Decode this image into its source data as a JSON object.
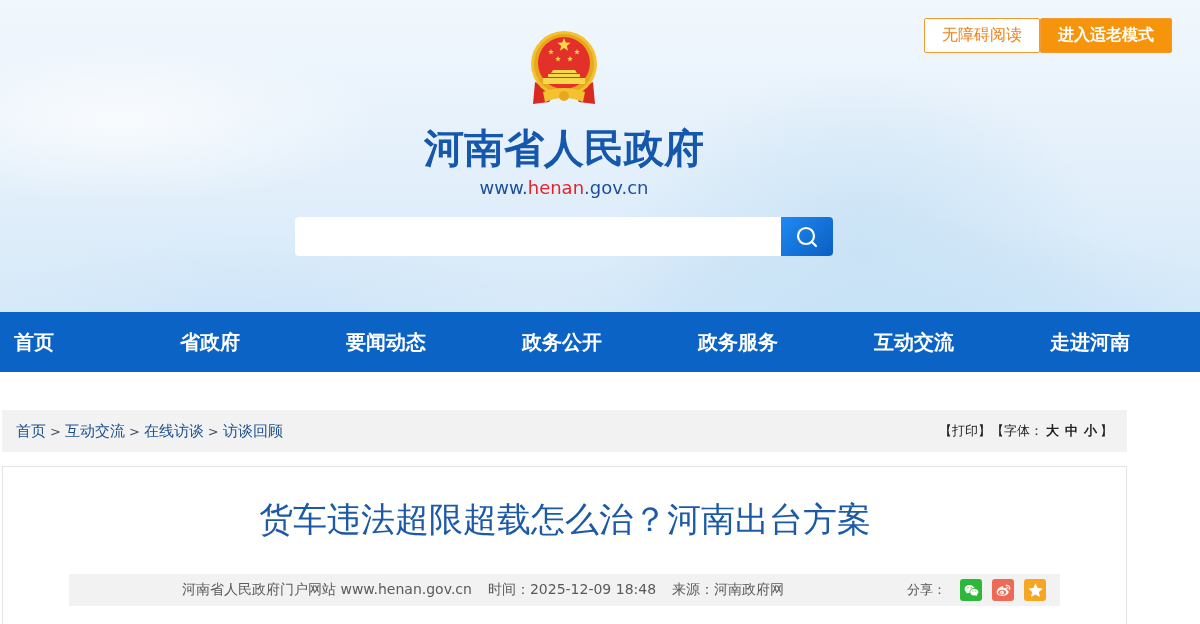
{
  "accessibility_buttons": [
    {
      "label": "无障碍阅读",
      "kind": "outline"
    },
    {
      "label": "进入适老模式",
      "kind": "filled"
    }
  ],
  "site": {
    "title": "河南省人民政府",
    "url_parts": [
      {
        "text": "www.",
        "accent": false
      },
      {
        "text": "henan",
        "accent": true
      },
      {
        "text": ".gov.cn",
        "accent": false
      }
    ]
  },
  "nav": [
    {
      "label": "首页"
    },
    {
      "label": "省政府"
    },
    {
      "label": "要闻动态"
    },
    {
      "label": "政务公开"
    },
    {
      "label": "政务服务"
    },
    {
      "label": "互动交流"
    },
    {
      "label": "走进河南"
    }
  ],
  "breadcrumb": [
    {
      "kind": "link",
      "text": "首页"
    },
    {
      "kind": "separator",
      "text": ">"
    },
    {
      "kind": "link",
      "text": "互动交流"
    },
    {
      "kind": "separator",
      "text": ">"
    },
    {
      "kind": "link",
      "text": "在线访谈"
    },
    {
      "kind": "separator",
      "text": ">"
    },
    {
      "kind": "link",
      "text": "访谈回顾"
    }
  ],
  "page_tools": {
    "print": "【打印】",
    "font_label": "【字体：",
    "font_sizes": [
      "大",
      "中",
      "小"
    ],
    "close": "】"
  },
  "article": {
    "title": "货车违法超限超载怎么治？河南出台方案",
    "meta": {
      "publisher": "河南省人民政府门户网站 www.henan.gov.cn",
      "time": "时间：2025-12-09 18:48",
      "source": "来源：河南政府网"
    },
    "share": {
      "label": "分享：",
      "targets": [
        {
          "kind": "wechat",
          "color": "#2eb83a"
        },
        {
          "kind": "weibo",
          "color": "#ef6a55"
        },
        {
          "kind": "favorite",
          "color": "#f6a623"
        }
      ]
    }
  }
}
